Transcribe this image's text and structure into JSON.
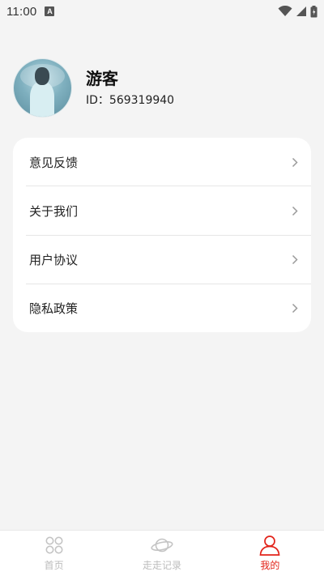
{
  "status_bar": {
    "time": "11:00",
    "notification_letter": "A"
  },
  "profile": {
    "name": "游客",
    "id_text": "ID：569319940"
  },
  "menu": {
    "items": [
      {
        "label": "意见反馈"
      },
      {
        "label": "关于我们"
      },
      {
        "label": "用户协议"
      },
      {
        "label": "隐私政策"
      }
    ]
  },
  "tabbar": {
    "tabs": [
      {
        "label": "首页",
        "icon": "home-grid-icon",
        "active": false
      },
      {
        "label": "走走记录",
        "icon": "planet-icon",
        "active": false
      },
      {
        "label": "我的",
        "icon": "person-icon",
        "active": true
      }
    ]
  },
  "colors": {
    "accent": "#e2231a",
    "background": "#f4f4f4",
    "card": "#ffffff",
    "inactive_tab": "#bcbcbc"
  }
}
